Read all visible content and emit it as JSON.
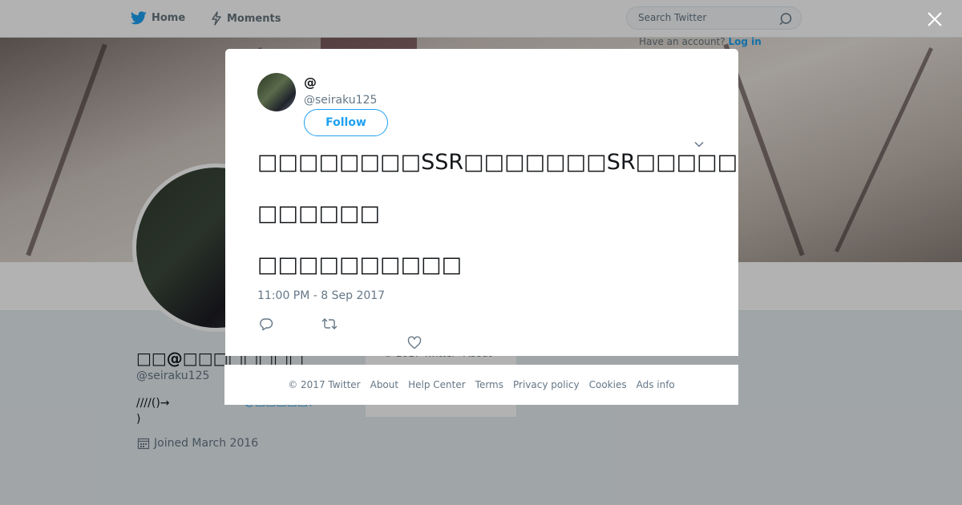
{
  "topbar": {
    "home_label": "Home",
    "moments_label": "Moments",
    "search_placeholder": "Search Twitter",
    "have_account": "Have an account?",
    "login_label": "Log in"
  },
  "profile": {
    "name": "□□@□□□□□□□□",
    "handle": "@seiraku125",
    "bio_line1": "////()→",
    "bio_line2": ")",
    "bio_link": "@□□□□□(",
    "joined": "Joined March 2016"
  },
  "side_footer": {
    "copyright": "© 2017 Twitter",
    "about": "About"
  },
  "modal": {
    "display_name": "@",
    "handle": "@seiraku125",
    "follow_label": "Follow",
    "tweet_lines": [
      "□□□□□□□□SSR□□□□□□□SR□□□□□□□□□□□□□□□□□□□□□",
      "□□□□□□",
      "□□□□□□□□□□"
    ],
    "timestamp": "11:00 PM - 8 Sep 2017"
  },
  "footer": {
    "copyright": "© 2017 Twitter",
    "links": [
      "About",
      "Help Center",
      "Terms",
      "Privacy policy",
      "Cookies",
      "Ads info"
    ]
  },
  "colors": {
    "brand": "#1da1f2",
    "secondary_text": "#657786",
    "overlay": "rgba(0,0,0,0.30)"
  },
  "icons": [
    "twitter-bird-icon",
    "lightning-icon",
    "search-icon",
    "close-icon",
    "chevron-down-icon",
    "reply-icon",
    "retweet-icon",
    "heart-icon",
    "calendar-icon"
  ]
}
